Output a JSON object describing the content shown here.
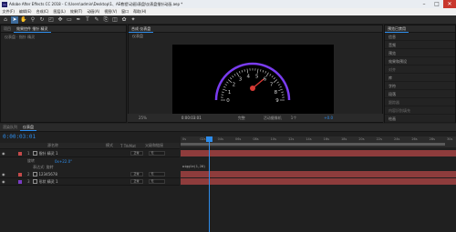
{
  "title_bar": {
    "app_icon": "Ae",
    "title": "Adobe After Effects CC 2018 - C:\\Users\\admin\\Desktop\\1、AE教程\\动画\\表盘\\仪表盘指针动画.aep *",
    "minimize": "–",
    "maximize": "□",
    "close": "✕"
  },
  "menu": [
    "文件(F)",
    "编辑(E)",
    "合成(C)",
    "图层(L)",
    "效果(T)",
    "动画(A)",
    "视图(V)",
    "窗口",
    "帮助(H)"
  ],
  "tools": [
    "home-icon",
    "select-arrow-icon",
    "hand-icon",
    "zoom-icon",
    "rotate-icon",
    "camera-icon",
    "pan-behind-icon",
    "rectangle-icon",
    "pen-icon",
    "type-icon",
    "brush-icon",
    "clone-icon",
    "eraser-icon",
    "roto-icon",
    "puppet-icon"
  ],
  "left_panel": {
    "tabs": [
      "项目",
      "效果控件 指针 精灵"
    ],
    "breadcrumb": "仪表盘 · 指针 精灵"
  },
  "viewer": {
    "tab": "合成 仪表盘",
    "sub_tab": "仪表盘",
    "dial_numbers": [
      "0",
      "1",
      "2",
      "3",
      "4",
      "5",
      "6",
      "7",
      "8",
      "9"
    ],
    "footer": {
      "zoom": "25%",
      "timecode": "0:00:03:01",
      "quality": "完整",
      "camera": "活动摄像机",
      "views": "1个",
      "offset": "+0.0"
    },
    "colors": {
      "arc": "#7a3cf0",
      "needle": "#d83a35",
      "marks": "#d8d8d8"
    }
  },
  "right_panel": {
    "title": "预览已禁用",
    "items": [
      "信息",
      "音频",
      "预览",
      "效果和预设",
      "对齐",
      "库",
      "字符",
      "段落",
      "跟踪器",
      "内容识别填充",
      "绘画",
      "画笔"
    ]
  },
  "timeline": {
    "tabs": [
      "渲染队列",
      "仪表盘"
    ],
    "time": "0:00:03:01",
    "header": [
      "源名称",
      "模式",
      "T TrkMat",
      "父级和链接"
    ],
    "layers": [
      {
        "num": "1",
        "name": "指针 精灵 1",
        "mode": "正常",
        "parent": "无",
        "swatch": "#c44a4a"
      },
      {
        "num": "2",
        "name": "12345678",
        "mode": "正常",
        "parent": "无",
        "swatch": "#c44a4a"
      },
      {
        "num": "3",
        "name": "形状 精灵 1",
        "mode": "正常",
        "parent": "无",
        "swatch": "#b14a4a"
      }
    ],
    "sub_rows": [
      "旋转",
      "表达式: 旋转"
    ],
    "expression": "0x+22.0°",
    "sub_label": "wiggle(1,20)",
    "ruler": [
      "0s",
      "02s",
      "04s",
      "06s",
      "08s",
      "10s",
      "12s",
      "14s",
      "16s",
      "18s",
      "20s",
      "22s",
      "24s",
      "26s",
      "28s",
      "30s"
    ]
  }
}
